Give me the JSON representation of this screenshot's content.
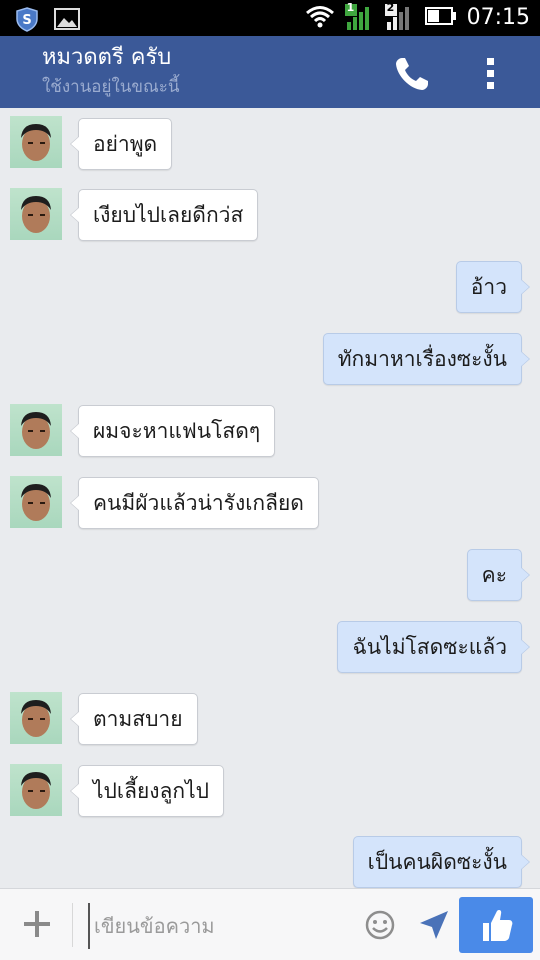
{
  "status_bar": {
    "time": "07:15",
    "sim1_label": "1",
    "sim2_label": "2",
    "icons": [
      "shield-icon",
      "image-icon",
      "wifi-icon",
      "signal-icon",
      "battery-icon"
    ]
  },
  "header": {
    "title": "หมวดตรี ครับ",
    "subtitle": "ใช้งานอยู่ในขณะนี้",
    "icons": [
      "phone-icon",
      "more-vertical-icon"
    ]
  },
  "messages": [
    {
      "side": "in",
      "text": "อย่าพูด"
    },
    {
      "side": "in",
      "text": "เงียบไปเลยดีกว่ส"
    },
    {
      "side": "out",
      "text": "อ้าว"
    },
    {
      "side": "out",
      "text": "ทักมาหาเรื่องซะงั้น"
    },
    {
      "side": "in",
      "text": "ผมจะหาแฟนโสดๆ"
    },
    {
      "side": "in",
      "text": "คนมีผัวแล้วน่ารังเกลียด"
    },
    {
      "side": "out",
      "text": "คะ"
    },
    {
      "side": "out",
      "text": "ฉันไม่โสดซะแล้ว"
    },
    {
      "side": "in",
      "text": "ตามสบาย"
    },
    {
      "side": "in",
      "text": "ไปเลี้ยงลูกไป"
    },
    {
      "side": "out",
      "text": "เป็นคนผิดซะงั้น"
    }
  ],
  "composer": {
    "placeholder": "เขียนข้อความ",
    "icons": [
      "plus-icon",
      "emoji-icon",
      "send-icon",
      "like-icon"
    ]
  },
  "colors": {
    "header_bg": "#3b5998",
    "chat_bg": "#e9ebee",
    "outgoing_bubble": "#d4e4fb",
    "incoming_bubble": "#ffffff",
    "like_button": "#4a8ae8"
  }
}
